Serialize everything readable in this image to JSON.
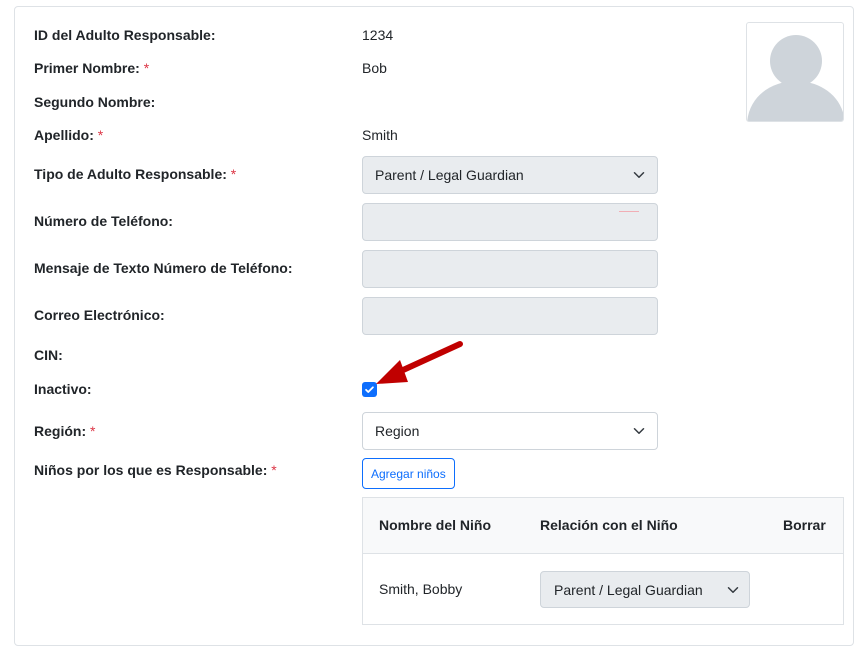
{
  "form": {
    "fields": [
      {
        "label": "ID del Adulto Responsable:",
        "required": false,
        "value": "1234"
      },
      {
        "label": "Primer Nombre:",
        "required": true,
        "value": "Bob"
      },
      {
        "label": "Segundo Nombre:",
        "required": false,
        "value": ""
      },
      {
        "label": "Apellido:",
        "required": true,
        "value": "Smith"
      },
      {
        "label": "Tipo de Adulto Responsable:",
        "required": true,
        "value": "Parent / Legal Guardian"
      },
      {
        "label": "Número de Teléfono:",
        "required": false,
        "value": ""
      },
      {
        "label": "Mensaje de Texto Número de Teléfono:",
        "required": false,
        "value": ""
      },
      {
        "label": "Correo Electrónico:",
        "required": false,
        "value": ""
      },
      {
        "label": "CIN:",
        "required": false,
        "value": ""
      },
      {
        "label": "Inactivo:",
        "required": false,
        "checked": true
      },
      {
        "label": "Región:",
        "required": true,
        "value": "Region"
      },
      {
        "label": "Niños por los que es Responsable:",
        "required": true
      }
    ],
    "required_mark": "*",
    "add_children_button": "Agregar niños"
  },
  "children_table": {
    "headers": [
      "Nombre del Niño",
      "Relación con el Niño",
      "Borrar"
    ],
    "rows": [
      {
        "name": "Smith, Bobby",
        "relation": "Parent / Legal Guardian"
      }
    ]
  },
  "colors": {
    "accent": "#0d6efd",
    "required": "#dc3545",
    "annotation_arrow": "#c00000",
    "disabled_bg": "#e9ecef"
  },
  "icons": {
    "avatar": "user-silhouette-icon",
    "chevron": "chevron-down-icon",
    "checkbox": "check-icon",
    "annotation": "red-arrow-icon"
  }
}
